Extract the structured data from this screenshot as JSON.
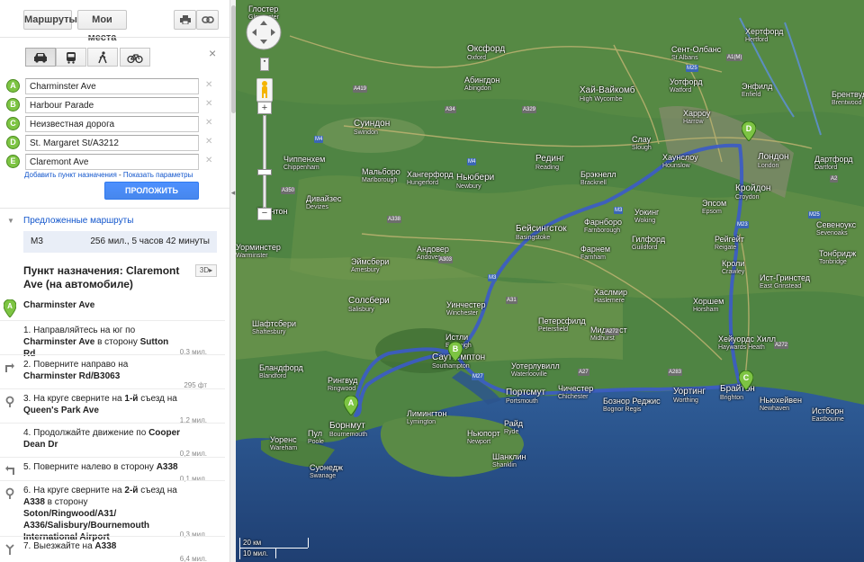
{
  "toolbar": {
    "routes_tab": "Маршруты",
    "my_places_tab": "Мои места"
  },
  "waypoints": [
    {
      "letter": "A",
      "value": "Charminster Ave"
    },
    {
      "letter": "B",
      "value": "Harbour Parade"
    },
    {
      "letter": "C",
      "value": "Неизвестная дорога"
    },
    {
      "letter": "D",
      "value": "St. Margaret St/A3212"
    },
    {
      "letter": "E",
      "value": "Claremont Ave"
    }
  ],
  "links": {
    "add_destination": "Добавить пункт назначения",
    "separator": " - ",
    "show_options": "Показать параметры"
  },
  "get_directions_button": "ПРОЛОЖИТЬ МАРШРУТ",
  "suggested": {
    "heading": "Предложенные маршруты",
    "route_name": "M3",
    "route_summary": "256 мил., 5 часов 42 минуты"
  },
  "destination": {
    "title": "Пункт назначения: Claremont Ave (на автомобиле)",
    "view_3d": "3D"
  },
  "start_label": "Charminster Ave",
  "steps": [
    {
      "num": "1.",
      "text_a": "Направляйтесь на юг по ",
      "bold_a": "Charminster Ave",
      "text_b": " в сторону ",
      "bold_b": "Sutton Rd",
      "dist": "0,3 мил."
    },
    {
      "num": "2.",
      "text_a": "Поверните направо на ",
      "bold_a": "Charminster Rd/B3063",
      "text_b": "",
      "bold_b": "",
      "dist": "295 фт"
    },
    {
      "num": "3.",
      "text_a": "На круге сверните на ",
      "bold_a": "1-й",
      "text_b": " съезд на ",
      "bold_b": "Queen's Park Ave",
      "dist": "1,2 мил."
    },
    {
      "num": "4.",
      "text_a": "Продолжайте движение по ",
      "bold_a": "Cooper Dean Dr",
      "text_b": "",
      "bold_b": "",
      "dist": "0,2 мил."
    },
    {
      "num": "5.",
      "text_a": "Поверните налево в сторону ",
      "bold_a": "A338",
      "text_b": "",
      "bold_b": "",
      "dist": "0,1 мил."
    },
    {
      "num": "6.",
      "text_a": "На круге сверните на ",
      "bold_a": "2-й",
      "text_b": " съезд на ",
      "bold_b": "A338",
      "text_c": " в сторону ",
      "bold_c": "Soton/Ringwood/A31/ A336/Salisbury/Bournemouth International Airport",
      "dist": "0,3 мил."
    },
    {
      "num": "7.",
      "text_a": "Выезжайте на ",
      "bold_a": "A338",
      "text_b": "",
      "bold_b": "",
      "dist": "6,4 мил."
    }
  ],
  "map": {
    "scale_km": "20 км",
    "scale_mi": "10 мил.",
    "markers": [
      "A",
      "B",
      "C",
      "D"
    ],
    "cities": [
      {
        "name": "Глостер",
        "sub": "Gloucester"
      },
      {
        "name": "Оксфорд",
        "sub": "Oxford"
      },
      {
        "name": "Абингдон",
        "sub": "Abingdon"
      },
      {
        "name": "Суиндон",
        "sub": "Swindon"
      },
      {
        "name": "Чиппенхем",
        "sub": "Chippenham"
      },
      {
        "name": "Мальборо",
        "sub": "Marlborough"
      },
      {
        "name": "Хангерфорд",
        "sub": "Hungerford"
      },
      {
        "name": "Ньюбери",
        "sub": "Newbury"
      },
      {
        "name": "Рединг",
        "sub": "Reading"
      },
      {
        "name": "Брэкнелл",
        "sub": "Bracknell"
      },
      {
        "name": "Слау",
        "sub": "Slough"
      },
      {
        "name": "Хаунслоу",
        "sub": "Hounslow"
      },
      {
        "name": "Лондон",
        "sub": "London"
      },
      {
        "name": "Кройдон",
        "sub": "Croydon"
      },
      {
        "name": "Хай-Вайкомб",
        "sub": "High Wycombe"
      },
      {
        "name": "Уотфорд",
        "sub": "Watford"
      },
      {
        "name": "Сент-Олбанс",
        "sub": "St Albans"
      },
      {
        "name": "Хертфорд",
        "sub": "Hertford"
      },
      {
        "name": "Энфилд",
        "sub": "Enfield"
      },
      {
        "name": "Харроу",
        "sub": "Harrow"
      },
      {
        "name": "Бейсингсток",
        "sub": "Basingstoke"
      },
      {
        "name": "Фарнборо",
        "sub": "Farnborough"
      },
      {
        "name": "Уокинг",
        "sub": "Woking"
      },
      {
        "name": "Гилфорд",
        "sub": "Guildford"
      },
      {
        "name": "Эпсом",
        "sub": "Epsom"
      },
      {
        "name": "Рейгейт",
        "sub": "Reigate"
      },
      {
        "name": "Фарнем",
        "sub": "Farnham"
      },
      {
        "name": "Андовер",
        "sub": "Andover"
      },
      {
        "name": "Эймсбери",
        "sub": "Amesbury"
      },
      {
        "name": "Солсбери",
        "sub": "Salisbury"
      },
      {
        "name": "Уинчестер",
        "sub": "Winchester"
      },
      {
        "name": "Истли",
        "sub": "Eastleigh"
      },
      {
        "name": "Саутгемптон",
        "sub": "Southampton"
      },
      {
        "name": "Портсмут",
        "sub": "Portsmouth"
      },
      {
        "name": "Уотерлувилл",
        "sub": "Waterlooville"
      },
      {
        "name": "Петерсфилд",
        "sub": "Petersfield"
      },
      {
        "name": "Хаслмир",
        "sub": "Haslemere"
      },
      {
        "name": "Мидхерст",
        "sub": "Midhurst"
      },
      {
        "name": "Хоршем",
        "sub": "Horsham"
      },
      {
        "name": "Кроли",
        "sub": "Crawley"
      },
      {
        "name": "Хейуордс Хилл",
        "sub": "Haywards Heath"
      },
      {
        "name": "Брайтон",
        "sub": "Brighton"
      },
      {
        "name": "Уортинг",
        "sub": "Worthing"
      },
      {
        "name": "Бознор Реджис",
        "sub": "Bognor Regis"
      },
      {
        "name": "Чичестер",
        "sub": "Chichester"
      },
      {
        "name": "Ньюхейвен",
        "sub": "Newhaven"
      },
      {
        "name": "Истборн",
        "sub": "Eastbourne"
      },
      {
        "name": "Рингвуд",
        "sub": "Ringwood"
      },
      {
        "name": "Борнмут",
        "sub": "Bournemouth"
      },
      {
        "name": "Пул",
        "sub": "Poole"
      },
      {
        "name": "Лимингтон",
        "sub": "Lymington"
      },
      {
        "name": "Ньюпорт",
        "sub": "Newport"
      },
      {
        "name": "Райд",
        "sub": "Ryde"
      },
      {
        "name": "Шанклин",
        "sub": "Shanklin"
      },
      {
        "name": "Суонедж",
        "sub": "Swanage"
      },
      {
        "name": "Шафтсбери",
        "sub": "Shaftesbury"
      },
      {
        "name": "Уорминстер",
        "sub": "Warminster"
      },
      {
        "name": "Дивайзес",
        "sub": "Devizes"
      },
      {
        "name": "Таунтон",
        "sub": ""
      },
      {
        "name": "Севеноукс",
        "sub": "Sevenoaks"
      },
      {
        "name": "Тонбридж",
        "sub": "Tonbridge"
      },
      {
        "name": "Дартфорд",
        "sub": "Dartford"
      },
      {
        "name": "Ист-Гринстед",
        "sub": "East Grinstead"
      },
      {
        "name": "Уоренс",
        "sub": "Wareham"
      },
      {
        "name": "Брентвуд",
        "sub": "Brentwood"
      },
      {
        "name": "Бландфорд",
        "sub": "Blandford"
      }
    ]
  }
}
